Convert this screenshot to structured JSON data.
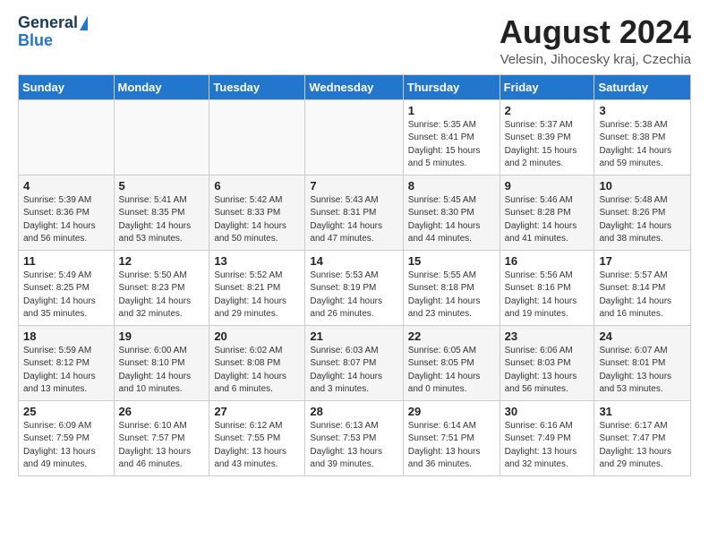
{
  "logo": {
    "line1": "General",
    "line2": "Blue"
  },
  "title": "August 2024",
  "location": "Velesin, Jihocesky kraj, Czechia",
  "weekdays": [
    "Sunday",
    "Monday",
    "Tuesday",
    "Wednesday",
    "Thursday",
    "Friday",
    "Saturday"
  ],
  "weeks": [
    [
      {
        "day": "",
        "info": ""
      },
      {
        "day": "",
        "info": ""
      },
      {
        "day": "",
        "info": ""
      },
      {
        "day": "",
        "info": ""
      },
      {
        "day": "1",
        "info": "Sunrise: 5:35 AM\nSunset: 8:41 PM\nDaylight: 15 hours\nand 5 minutes."
      },
      {
        "day": "2",
        "info": "Sunrise: 5:37 AM\nSunset: 8:39 PM\nDaylight: 15 hours\nand 2 minutes."
      },
      {
        "day": "3",
        "info": "Sunrise: 5:38 AM\nSunset: 8:38 PM\nDaylight: 14 hours\nand 59 minutes."
      }
    ],
    [
      {
        "day": "4",
        "info": "Sunrise: 5:39 AM\nSunset: 8:36 PM\nDaylight: 14 hours\nand 56 minutes."
      },
      {
        "day": "5",
        "info": "Sunrise: 5:41 AM\nSunset: 8:35 PM\nDaylight: 14 hours\nand 53 minutes."
      },
      {
        "day": "6",
        "info": "Sunrise: 5:42 AM\nSunset: 8:33 PM\nDaylight: 14 hours\nand 50 minutes."
      },
      {
        "day": "7",
        "info": "Sunrise: 5:43 AM\nSunset: 8:31 PM\nDaylight: 14 hours\nand 47 minutes."
      },
      {
        "day": "8",
        "info": "Sunrise: 5:45 AM\nSunset: 8:30 PM\nDaylight: 14 hours\nand 44 minutes."
      },
      {
        "day": "9",
        "info": "Sunrise: 5:46 AM\nSunset: 8:28 PM\nDaylight: 14 hours\nand 41 minutes."
      },
      {
        "day": "10",
        "info": "Sunrise: 5:48 AM\nSunset: 8:26 PM\nDaylight: 14 hours\nand 38 minutes."
      }
    ],
    [
      {
        "day": "11",
        "info": "Sunrise: 5:49 AM\nSunset: 8:25 PM\nDaylight: 14 hours\nand 35 minutes."
      },
      {
        "day": "12",
        "info": "Sunrise: 5:50 AM\nSunset: 8:23 PM\nDaylight: 14 hours\nand 32 minutes."
      },
      {
        "day": "13",
        "info": "Sunrise: 5:52 AM\nSunset: 8:21 PM\nDaylight: 14 hours\nand 29 minutes."
      },
      {
        "day": "14",
        "info": "Sunrise: 5:53 AM\nSunset: 8:19 PM\nDaylight: 14 hours\nand 26 minutes."
      },
      {
        "day": "15",
        "info": "Sunrise: 5:55 AM\nSunset: 8:18 PM\nDaylight: 14 hours\nand 23 minutes."
      },
      {
        "day": "16",
        "info": "Sunrise: 5:56 AM\nSunset: 8:16 PM\nDaylight: 14 hours\nand 19 minutes."
      },
      {
        "day": "17",
        "info": "Sunrise: 5:57 AM\nSunset: 8:14 PM\nDaylight: 14 hours\nand 16 minutes."
      }
    ],
    [
      {
        "day": "18",
        "info": "Sunrise: 5:59 AM\nSunset: 8:12 PM\nDaylight: 14 hours\nand 13 minutes."
      },
      {
        "day": "19",
        "info": "Sunrise: 6:00 AM\nSunset: 8:10 PM\nDaylight: 14 hours\nand 10 minutes."
      },
      {
        "day": "20",
        "info": "Sunrise: 6:02 AM\nSunset: 8:08 PM\nDaylight: 14 hours\nand 6 minutes."
      },
      {
        "day": "21",
        "info": "Sunrise: 6:03 AM\nSunset: 8:07 PM\nDaylight: 14 hours\nand 3 minutes."
      },
      {
        "day": "22",
        "info": "Sunrise: 6:05 AM\nSunset: 8:05 PM\nDaylight: 14 hours\nand 0 minutes."
      },
      {
        "day": "23",
        "info": "Sunrise: 6:06 AM\nSunset: 8:03 PM\nDaylight: 13 hours\nand 56 minutes."
      },
      {
        "day": "24",
        "info": "Sunrise: 6:07 AM\nSunset: 8:01 PM\nDaylight: 13 hours\nand 53 minutes."
      }
    ],
    [
      {
        "day": "25",
        "info": "Sunrise: 6:09 AM\nSunset: 7:59 PM\nDaylight: 13 hours\nand 49 minutes."
      },
      {
        "day": "26",
        "info": "Sunrise: 6:10 AM\nSunset: 7:57 PM\nDaylight: 13 hours\nand 46 minutes."
      },
      {
        "day": "27",
        "info": "Sunrise: 6:12 AM\nSunset: 7:55 PM\nDaylight: 13 hours\nand 43 minutes."
      },
      {
        "day": "28",
        "info": "Sunrise: 6:13 AM\nSunset: 7:53 PM\nDaylight: 13 hours\nand 39 minutes."
      },
      {
        "day": "29",
        "info": "Sunrise: 6:14 AM\nSunset: 7:51 PM\nDaylight: 13 hours\nand 36 minutes."
      },
      {
        "day": "30",
        "info": "Sunrise: 6:16 AM\nSunset: 7:49 PM\nDaylight: 13 hours\nand 32 minutes."
      },
      {
        "day": "31",
        "info": "Sunrise: 6:17 AM\nSunset: 7:47 PM\nDaylight: 13 hours\nand 29 minutes."
      }
    ]
  ]
}
